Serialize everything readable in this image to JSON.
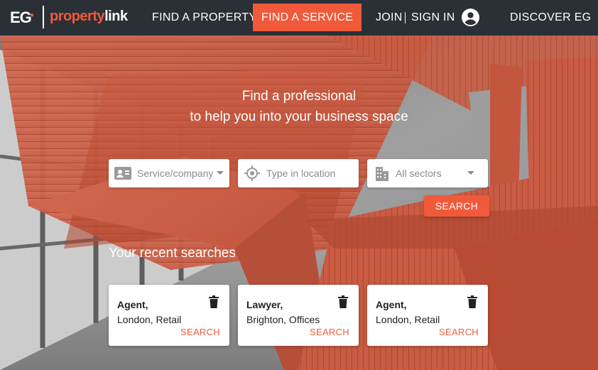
{
  "brand": {
    "logo_eg": "EG",
    "logo_property": "property",
    "logo_link": "link"
  },
  "nav": {
    "find_property": "FIND A PROPERTY",
    "find_service": "FIND A SERVICE",
    "join": "JOIN",
    "sign_in": "SIGN IN",
    "discover": "DISCOVER EG"
  },
  "hero": {
    "headline_line1": "Find a professional",
    "headline_line2": "to help you into your business space"
  },
  "search": {
    "service_placeholder": "Service/company",
    "location_placeholder": "Type in location",
    "sectors_value": "All sectors",
    "button_label": "SEARCH"
  },
  "recent": {
    "title": "Your recent searches",
    "items": [
      {
        "type": "Agent,",
        "location": "London, Retail",
        "action": "SEARCH"
      },
      {
        "type": "Lawyer,",
        "location": "Brighton, Offices",
        "action": "SEARCH"
      },
      {
        "type": "Agent,",
        "location": "London, Retail",
        "action": "SEARCH"
      }
    ]
  },
  "colors": {
    "accent": "#f05a3a",
    "nav_bg": "#2b2f36",
    "text": "#222222",
    "placeholder": "#8a8a8a"
  }
}
